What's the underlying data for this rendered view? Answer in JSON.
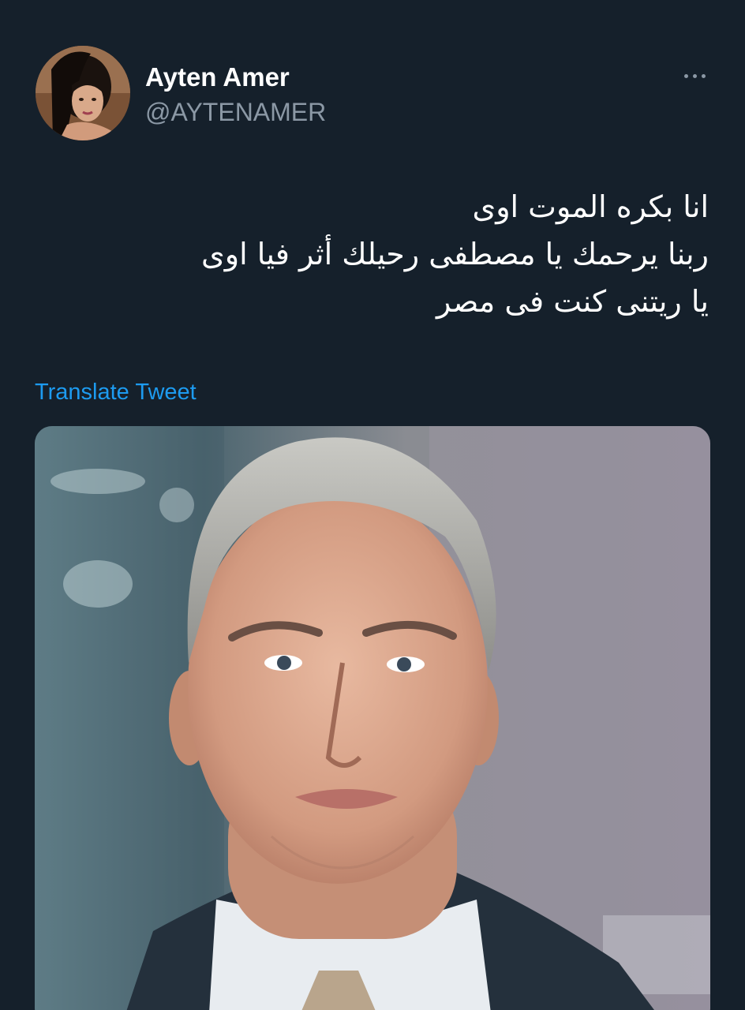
{
  "author": {
    "display_name": "Ayten Amer",
    "handle": "@AYTENAMER",
    "avatar_icon": "profile-photo-avatar"
  },
  "tweet": {
    "lines": [
      "انا بكره الموت اوى",
      "ربنا يرحمك يا مصطفى رحيلك أثر فيا اوى",
      "يا ريتنى كنت فى مصر"
    ],
    "translate_label": "Translate Tweet",
    "more_icon": "more-options-icon"
  },
  "media": {
    "kind": "photo",
    "subject": "portrait-photo"
  },
  "colors": {
    "background": "#15202b",
    "text_primary": "#ffffff",
    "text_secondary": "#8b98a5",
    "link": "#1d9bf0"
  }
}
